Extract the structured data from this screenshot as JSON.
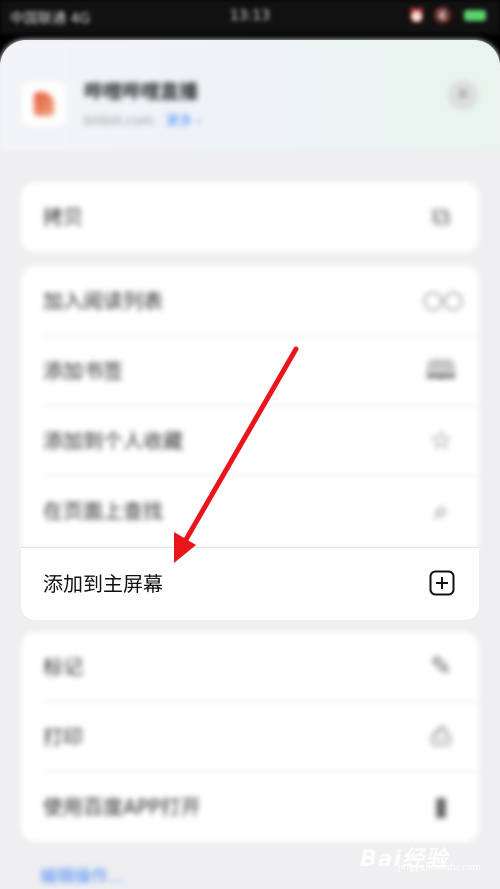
{
  "status_bar": {
    "carrier": "中国联通 4G",
    "time": "13:13",
    "icons": "⏰ 🔇"
  },
  "header": {
    "site_title": "哔哩哔哩直播",
    "site_url": "bilibili.com",
    "site_link": "更多 ›",
    "close_icon": "✕"
  },
  "menu": {
    "group1": [
      {
        "label": "拷贝",
        "icon": "copy-icon",
        "glyph": "⧉"
      }
    ],
    "group2": [
      {
        "label": "加入阅读列表",
        "icon": "glasses-icon",
        "glyph": "◯◯"
      },
      {
        "label": "添加书签",
        "icon": "book-icon",
        "glyph": "🕮"
      },
      {
        "label": "添加到个人收藏",
        "icon": "star-icon",
        "glyph": "☆"
      },
      {
        "label": "在页面上查找",
        "icon": "search-icon",
        "glyph": "⌕"
      }
    ],
    "focus_item": {
      "label": "添加到主屏幕",
      "icon": "add-square-icon"
    },
    "group3": [
      {
        "label": "标记",
        "icon": "markup-icon",
        "glyph": "✎"
      },
      {
        "label": "打印",
        "icon": "print-icon",
        "glyph": "⎙"
      },
      {
        "label": "使用百度APP打开",
        "icon": "app-icon",
        "glyph": "▮"
      }
    ],
    "edit_actions": "编辑操作..."
  },
  "watermark": {
    "text": "Bai经验",
    "sub": "jingyan.baidu.com"
  },
  "colors": {
    "arrow": "#e8161b",
    "sheet_bg": "#efeff2",
    "link": "#4d8cf5"
  }
}
